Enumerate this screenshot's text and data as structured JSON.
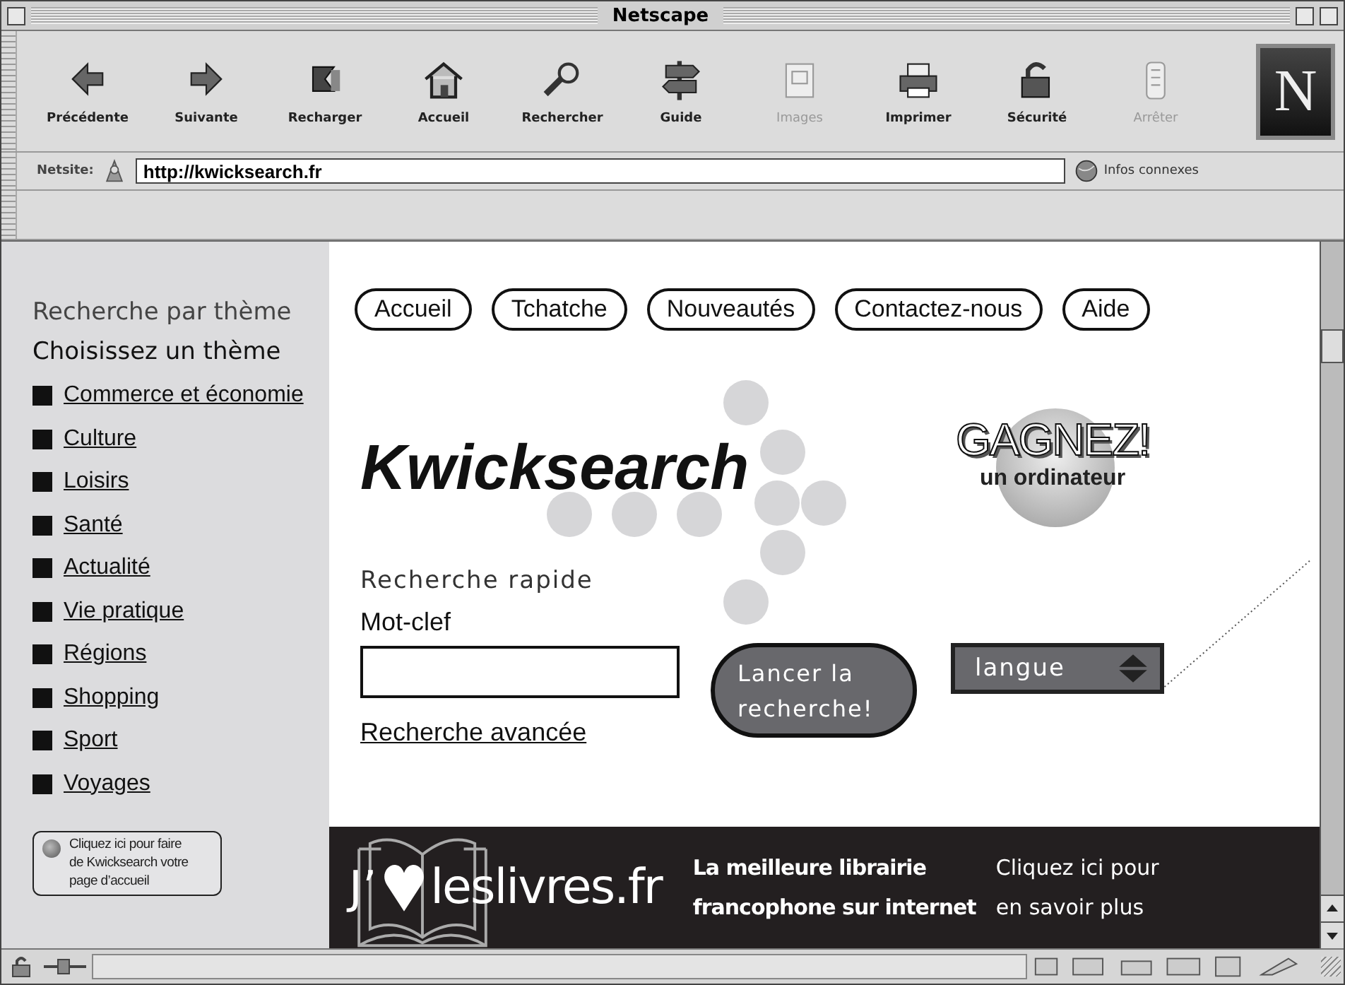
{
  "window": {
    "title": "Netscape"
  },
  "toolbar": {
    "buttons": [
      {
        "label": "Précédente",
        "disabled": false
      },
      {
        "label": "Suivante",
        "disabled": false
      },
      {
        "label": "Recharger",
        "disabled": false
      },
      {
        "label": "Accueil",
        "disabled": false
      },
      {
        "label": "Rechercher",
        "disabled": false
      },
      {
        "label": "Guide",
        "disabled": false
      },
      {
        "label": "Images",
        "disabled": true
      },
      {
        "label": "Imprimer",
        "disabled": false
      },
      {
        "label": "Sécurité",
        "disabled": false
      },
      {
        "label": "Arrêter",
        "disabled": true
      }
    ],
    "logo_letter": "N"
  },
  "location": {
    "label": "Netsite:",
    "url": "http://kwicksearch.fr",
    "related_button": "Infos connexes"
  },
  "sidebar": {
    "heading": "Recherche par thème",
    "subheading": "Choisissez un thème",
    "themes": [
      "Commerce et économie",
      "Culture",
      "Loisirs",
      "Santé",
      "Actualité",
      "Vie pratique",
      "Régions",
      "Shopping",
      "Sport",
      "Voyages"
    ],
    "homepage_button": [
      "Cliquez ici pour faire",
      "de Kwicksearch votre",
      "page d’accueil"
    ]
  },
  "nav": [
    "Accueil",
    "Tchatche",
    "Nouveautés",
    "Contactez-nous",
    "Aide"
  ],
  "logo": "Kwicksearch",
  "promo": {
    "headline": "GAGNEZ!",
    "subline": "un ordinateur"
  },
  "quick_search": {
    "title": "Recherche rapide",
    "label": "Mot-clef",
    "advanced_link": "Recherche avancée",
    "submit": [
      "Lancer la",
      "recherche!"
    ],
    "language_select": "langue"
  },
  "banner": {
    "logo_prefix": "J’",
    "logo_text": "leslivres.fr",
    "tagline": [
      "La meilleure librairie",
      "francophone sur internet"
    ],
    "cta": [
      "Cliquez ici pour",
      "en savoir plus"
    ]
  },
  "status_bar": {
    "progress": {
      "level": 0
    }
  }
}
